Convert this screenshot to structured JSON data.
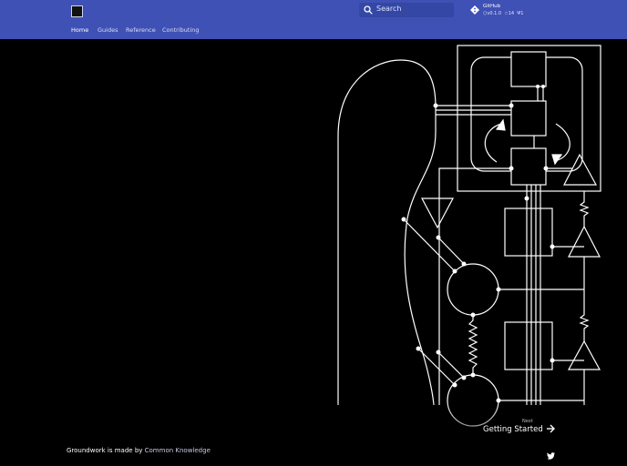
{
  "header": {
    "search_placeholder": "Search",
    "repo": {
      "name": "GitHub",
      "version": "v0.1.0",
      "stars": "14",
      "forks": "1"
    },
    "tabs": [
      {
        "label": "Home",
        "active": true
      },
      {
        "label": "Guides",
        "active": false
      },
      {
        "label": "Reference",
        "active": false
      },
      {
        "label": "Contributing",
        "active": false
      }
    ]
  },
  "next": {
    "label": "Next",
    "title": "Getting Started"
  },
  "footer": {
    "prefix": "Groundwork is made by",
    "link": "Common Knowledge"
  },
  "colors": {
    "header": "#3f51b5",
    "search": "#3447a5",
    "background": "#000000"
  },
  "icons": [
    "logo-icon",
    "search-icon",
    "git-icon",
    "tag-icon",
    "star-icon",
    "fork-icon",
    "arrow-right-icon",
    "twitter-icon"
  ]
}
